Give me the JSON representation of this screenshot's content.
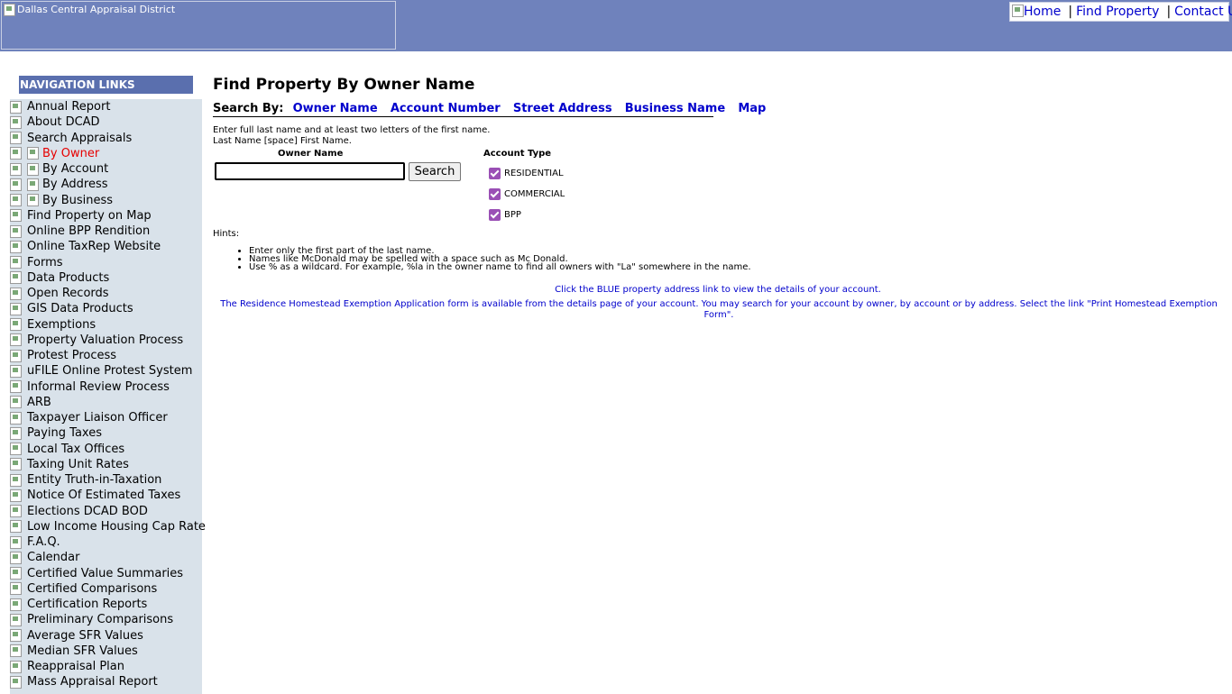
{
  "header": {
    "logo_alt": "Dallas Central Appraisal District",
    "links": {
      "home": "Home",
      "find_property": "Find Property",
      "contact_us": "Contact Us",
      "separator": "|"
    }
  },
  "nav": {
    "header": "NAVIGATION LINKS",
    "items": [
      {
        "label": "Annual Report",
        "level": 1
      },
      {
        "label": "About DCAD",
        "level": 1
      },
      {
        "label": "Search Appraisals",
        "level": 1
      },
      {
        "label": "By Owner",
        "level": 2,
        "active": true
      },
      {
        "label": "By Account",
        "level": 2
      },
      {
        "label": "By Address",
        "level": 2
      },
      {
        "label": "By Business",
        "level": 2
      },
      {
        "label": "Find Property on Map",
        "level": 1
      },
      {
        "label": "Online BPP Rendition",
        "level": 1
      },
      {
        "label": "Online TaxRep Website",
        "level": 1
      },
      {
        "label": "Forms",
        "level": 1
      },
      {
        "label": "Data Products",
        "level": 1
      },
      {
        "label": "Open Records",
        "level": 1
      },
      {
        "label": "GIS Data Products",
        "level": 1
      },
      {
        "label": "Exemptions",
        "level": 1
      },
      {
        "label": "Property Valuation Process",
        "level": 1
      },
      {
        "label": "Protest Process",
        "level": 1
      },
      {
        "label": "uFILE Online Protest System",
        "level": 1
      },
      {
        "label": "Informal Review Process",
        "level": 1
      },
      {
        "label": "ARB",
        "level": 1
      },
      {
        "label": "Taxpayer Liaison Officer",
        "level": 1
      },
      {
        "label": "Paying Taxes",
        "level": 1
      },
      {
        "label": "Local Tax Offices",
        "level": 1
      },
      {
        "label": "Taxing Unit Rates",
        "level": 1
      },
      {
        "label": "Entity Truth-in-Taxation",
        "level": 1
      },
      {
        "label": "Notice Of Estimated Taxes",
        "level": 1
      },
      {
        "label": "Elections DCAD BOD",
        "level": 1
      },
      {
        "label": "Low Income Housing Cap Rate",
        "level": 1
      },
      {
        "label": "F.A.Q.",
        "level": 1
      },
      {
        "label": "Calendar",
        "level": 1
      },
      {
        "label": "Certified Value Summaries",
        "level": 1
      },
      {
        "label": "Certified Comparisons",
        "level": 1
      },
      {
        "label": "Certification Reports",
        "level": 1
      },
      {
        "label": "Preliminary Comparisons",
        "level": 1
      },
      {
        "label": "Average SFR Values",
        "level": 1
      },
      {
        "label": "Median SFR Values",
        "level": 1
      },
      {
        "label": "Reappraisal Plan",
        "level": 1
      },
      {
        "label": "Mass Appraisal Report",
        "level": 1
      }
    ]
  },
  "main": {
    "title": "Find Property By Owner Name",
    "search_by": {
      "label": "Search By:",
      "options": [
        "Owner Name",
        "Account Number",
        "Street Address",
        "Business Name",
        "Map"
      ]
    },
    "instructions_line1": "Enter full last name and at least two letters of the first name.",
    "instructions_line2": "Last Name [space] First Name.",
    "owner_name_label": "Owner Name",
    "owner_name_value": "",
    "search_button": "Search",
    "account_type_label": "Account Type",
    "account_types": [
      {
        "label": "RESIDENTIAL",
        "checked": true
      },
      {
        "label": "COMMERCIAL",
        "checked": true
      },
      {
        "label": "BPP",
        "checked": true
      }
    ],
    "hints_label": "Hints:",
    "hints": [
      "Enter only the first part of the last name.",
      "Names like McDonald may be spelled with a space such as Mc Donald.",
      "Use % as a wildcard. For example, %la in the owner name to find all owners with \"La\" somewhere in the name."
    ],
    "note_blue_link": "Click the BLUE property address link to view the details of your account.",
    "note_homestead": "The Residence Homestead Exemption Application form is available from the details page of your account. You may search for your account by owner, by account or by address. Select the link \"Print Homestead Exemption Form\"."
  },
  "colors": {
    "header_bg": "#6f82bc",
    "nav_header_bg": "#5a6fae",
    "nav_panel_bg": "#d9e2ea",
    "link": "#0000cc",
    "active_nav": "#e60000",
    "checkbox": "#9a4fb5"
  }
}
